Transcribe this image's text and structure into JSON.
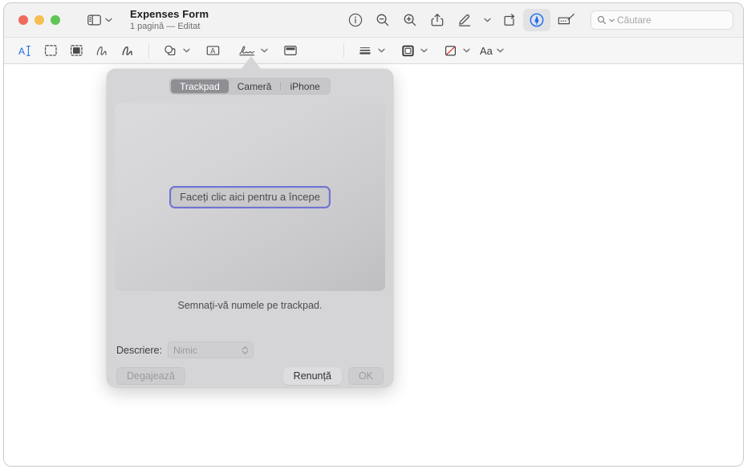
{
  "window": {
    "title": "Expenses Form",
    "subtitle": "1 pagină — Editat",
    "traffic_lights": [
      "close",
      "minimize",
      "zoom"
    ],
    "colors": {
      "accent_blue": "#1b6ef3",
      "focus_ring": "#6f73d8",
      "popover_bg": "#d5d5d7",
      "titlebar_bg": "#f2f2f2",
      "markupbar_bg": "#f6f6f6",
      "segment_selected_bg": "#8e8e93",
      "traffic_red": "#ed6a5e",
      "traffic_yellow": "#f5bf4f",
      "traffic_green": "#61c454"
    }
  },
  "toolbar": {
    "sidebar_icon": "sidebar-icon",
    "sidebar_chevron": "chevron-down-icon",
    "right_items": [
      {
        "name": "info-button",
        "icon": "info-circle-icon"
      },
      {
        "name": "zoom-out-button",
        "icon": "magnifier-minus-icon"
      },
      {
        "name": "zoom-in-button",
        "icon": "magnifier-plus-icon"
      },
      {
        "name": "share-button",
        "icon": "share-icon"
      },
      {
        "name": "markup-pen-button",
        "icon": "pen-underline-icon"
      },
      {
        "name": "pen-options-chevron",
        "icon": "chevron-down-icon"
      },
      {
        "name": "rotate-button",
        "icon": "rotate-icon"
      },
      {
        "name": "markup-toolbar-toggle",
        "icon": "pen-nib-circle-icon",
        "active": true
      },
      {
        "name": "sign-button",
        "icon": "signature-pad-icon"
      }
    ],
    "search": {
      "placeholder": "Căutare",
      "icon": "search-icon",
      "chevron": "chevron-down-icon"
    }
  },
  "markup_toolbar": {
    "items": [
      {
        "name": "text-selection-tool",
        "icon": "text-select-icon",
        "selected": true
      },
      {
        "name": "rectangular-selection-tool",
        "icon": "dashed-rect-icon",
        "selected": false
      },
      {
        "name": "instant-alpha-tool",
        "icon": "filled-select-icon",
        "selected": false
      },
      {
        "name": "sketch-tool",
        "icon": "sketch-icon",
        "selected": false
      },
      {
        "name": "draw-tool",
        "icon": "draw-icon",
        "selected": false
      },
      {
        "name": "shapes-tool",
        "icon": "shapes-icon",
        "selected": false
      },
      {
        "name": "text-box-tool",
        "icon": "text-box-icon",
        "selected": false
      },
      {
        "name": "signature-tool",
        "icon": "signature-icon",
        "selected": false
      },
      {
        "name": "note-tool",
        "icon": "note-icon",
        "selected": false
      },
      {
        "name": "shape-style-tool",
        "icon": "line-style-icon",
        "selected": false
      },
      {
        "name": "border-color-tool",
        "icon": "border-square-icon",
        "selected": false
      },
      {
        "name": "fill-color-tool",
        "icon": "no-fill-icon",
        "selected": false
      },
      {
        "name": "font-style-tool",
        "icon": "aa-icon",
        "label": "Aa",
        "selected": false
      }
    ]
  },
  "popover": {
    "name": "signature-capture-popover",
    "segments": [
      {
        "label": "Trackpad",
        "selected": true
      },
      {
        "label": "Cameră",
        "selected": false
      },
      {
        "label": "iPhone",
        "selected": false
      }
    ],
    "capture": {
      "start_button_label": "Faceți clic aici pentru a începe"
    },
    "instruction": "Semnați-vă numele pe trackpad.",
    "description": {
      "label": "Descriere:",
      "value": "Nimic",
      "enabled": false,
      "chevron_icon": "up-down-chevron-icon"
    },
    "buttons": [
      {
        "label": "Degajează",
        "name": "clear-button",
        "enabled": false
      },
      {
        "label": "Renunță",
        "name": "cancel-button",
        "enabled": true
      },
      {
        "label": "OK",
        "name": "ok-button",
        "enabled": false
      }
    ]
  }
}
